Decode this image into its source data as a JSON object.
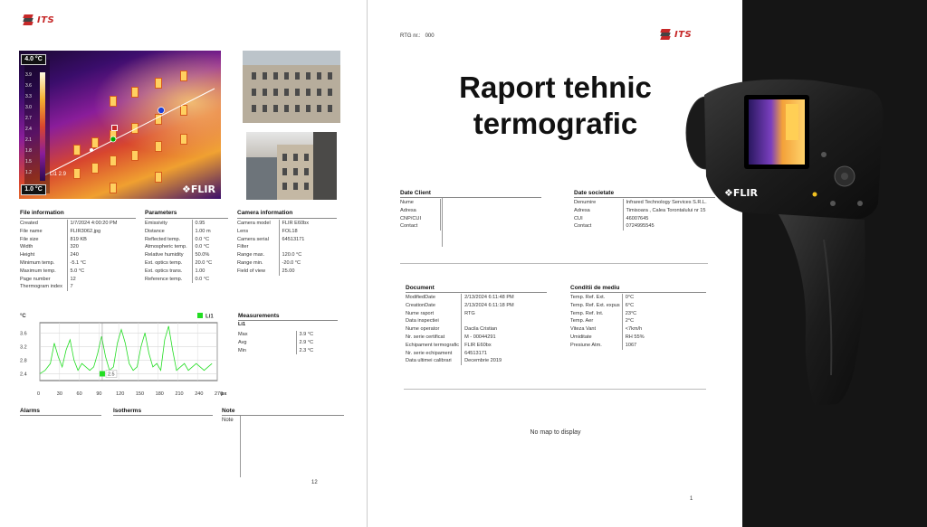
{
  "left": {
    "logo_text": "ITS",
    "scale_top": "4.0 °C",
    "scale_bottom": "1.0 °C",
    "scale_ticks": [
      "3.9",
      "3.6",
      "3.3",
      "3.0",
      "2.7",
      "2.4",
      "2.1",
      "1.8",
      "1.5",
      "1.2"
    ],
    "line_marker": "Li1 2.9",
    "flir_brand": "FLIR",
    "file_info": {
      "title": "File information",
      "rows": [
        [
          "Created",
          "1/7/2024 4:00:20 PM"
        ],
        [
          "File name",
          "FLIR3062.jpg"
        ],
        [
          "File size",
          "819 KB"
        ],
        [
          "Width",
          "320"
        ],
        [
          "Height",
          "240"
        ],
        [
          "Minimum temp.",
          "-5.1 °C"
        ],
        [
          "Maximum temp.",
          "5.0 °C"
        ],
        [
          "Page number",
          "12"
        ],
        [
          "Thermogram index",
          "7"
        ]
      ]
    },
    "parameters": {
      "title": "Parameters",
      "rows": [
        [
          "Emissivity",
          "0.95"
        ],
        [
          "Distance",
          "1.00 m"
        ],
        [
          "Reflected temp.",
          "0.0 °C"
        ],
        [
          "Atmospheric temp.",
          "0.0 °C"
        ],
        [
          "Relative humidity",
          "50.0%"
        ],
        [
          "Ext. optics temp.",
          "20.0 °C"
        ],
        [
          "Ext. optics trans.",
          "1.00"
        ],
        [
          "Reference temp.",
          "0.0 °C"
        ]
      ]
    },
    "camera_info": {
      "title": "Camera information",
      "rows": [
        [
          "Camera model",
          "FLIR E60bx"
        ],
        [
          "Lens",
          "FOL18"
        ],
        [
          "Camera serial",
          "64513171"
        ],
        [
          "Filter",
          ""
        ],
        [
          "Range max.",
          "120.0 °C"
        ],
        [
          "Range min.",
          "-20.0 °C"
        ],
        [
          "Field of view",
          "25.00"
        ]
      ]
    },
    "measurements": {
      "title": "Measurements",
      "subtitle": "Li1",
      "rows": [
        [
          "Max",
          "3.9 °C"
        ],
        [
          "Avg",
          "2.9 °C"
        ],
        [
          "Min",
          "2.3 °C"
        ]
      ]
    },
    "alarms_title": "Alarms",
    "isotherms_title": "Isotherms",
    "note_title": "Note",
    "note_label": "Note",
    "page_number": "12"
  },
  "right": {
    "rtg_label": "RTG nr.:",
    "rtg_value": "000",
    "logo_text": "ITS",
    "title_line1": "Raport tehnic",
    "title_line2": "termografic",
    "client": {
      "title": "Date Client",
      "rows": [
        [
          "Nume",
          ""
        ],
        [
          "Adresa",
          ""
        ],
        [
          "CNP/CUI",
          ""
        ],
        [
          "Contact",
          ""
        ]
      ]
    },
    "company": {
      "title": "Date societate",
      "rows": [
        [
          "Denumire",
          "Infrared Technology Services S.R.L."
        ],
        [
          "Adresa",
          "Timisoara , Calea Torontalului nr 15"
        ],
        [
          "CUI",
          "46007645"
        ],
        [
          "Contact",
          "0724995545"
        ]
      ]
    },
    "document": {
      "title": "Document",
      "rows": [
        [
          "ModifiedDate",
          "2/13/2024 6:11:48 PM"
        ],
        [
          "CreationDate",
          "2/13/2024 6:11:18 PM"
        ],
        [
          "Nume raport",
          "RTG"
        ],
        [
          "Data inspectiei",
          ""
        ],
        [
          "Nume operator",
          "Dacila Cristian"
        ],
        [
          "Nr. serie certificat",
          "M - 00044291"
        ],
        [
          "Echipament termografic",
          "FLIR E60bx"
        ],
        [
          "Nr. serie echipament",
          "64513171"
        ],
        [
          "Data ultimei calibrari",
          "Decembrie 2019"
        ]
      ]
    },
    "conditions": {
      "title": "Conditii de mediu",
      "rows": [
        [
          "Temp. Ref. Ext.",
          "0°C"
        ],
        [
          "Temp. Ref. Ext. expus",
          "6°C"
        ],
        [
          "Temp. Ref. Int.",
          "23°C"
        ],
        [
          "Temp. Aer",
          "2°C"
        ],
        [
          "Viteza Vant",
          "<7km/h"
        ],
        [
          "Umiditate",
          "RH 55%"
        ],
        [
          "Presiune Atm.",
          "1067"
        ]
      ]
    },
    "map_text": "No map to display",
    "page_number": "1"
  },
  "camera": {
    "brand": "FLIR"
  },
  "chart_data": {
    "type": "line",
    "title": "",
    "legend": [
      "Li1"
    ],
    "ylabel": "°C",
    "xlabel": "px",
    "x_ticks": [
      "0",
      "30",
      "60",
      "90",
      "120",
      "150",
      "180",
      "210",
      "240",
      "270"
    ],
    "y_ticks": [
      "3.6",
      "3.2",
      "2.8",
      "2.4"
    ],
    "xlim": [
      0,
      270
    ],
    "ylim": [
      2.2,
      3.9
    ],
    "series": [
      {
        "name": "Li1",
        "color": "#22dd22",
        "x": [
          0,
          8,
          16,
          22,
          28,
          34,
          40,
          46,
          52,
          58,
          64,
          70,
          76,
          82,
          88,
          94,
          100,
          106,
          112,
          118,
          124,
          130,
          136,
          142,
          148,
          154,
          160,
          166,
          172,
          178,
          184,
          190,
          196,
          202,
          208,
          214,
          220,
          226,
          232,
          238,
          244,
          250,
          256,
          262
        ],
        "y": [
          2.4,
          2.5,
          2.7,
          3.3,
          2.9,
          2.6,
          3.1,
          3.4,
          2.8,
          2.5,
          2.7,
          2.6,
          2.5,
          2.6,
          3.0,
          3.5,
          2.9,
          2.5,
          2.6,
          3.3,
          3.7,
          3.3,
          2.7,
          2.5,
          2.6,
          3.2,
          3.6,
          3.0,
          2.6,
          2.7,
          2.5,
          3.4,
          3.8,
          3.1,
          2.5,
          2.6,
          2.7,
          2.5,
          2.6,
          2.7,
          2.6,
          2.5,
          2.6,
          2.7
        ]
      }
    ],
    "cursor_label": "2.5"
  }
}
